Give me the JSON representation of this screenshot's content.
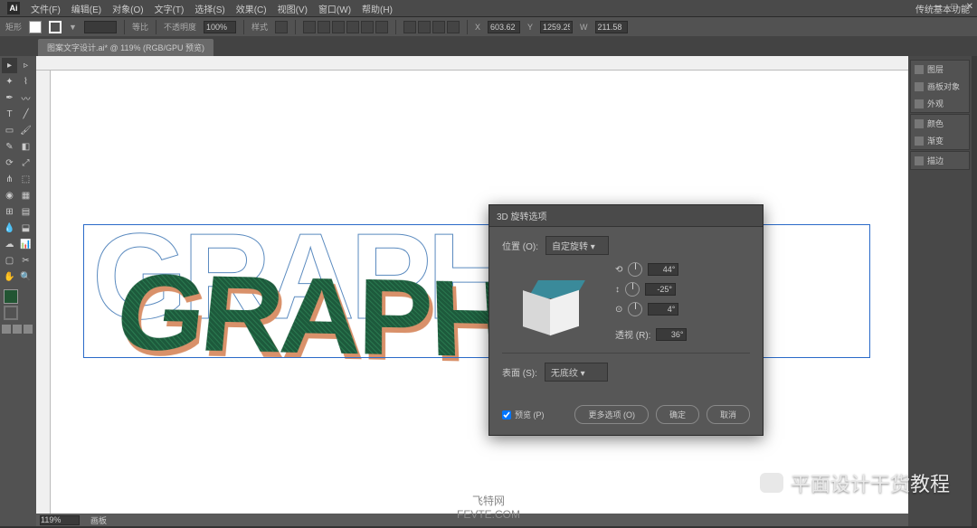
{
  "app": {
    "logo": "Ai",
    "title": "传统基本功能"
  },
  "menu": [
    "文件(F)",
    "编辑(E)",
    "对象(O)",
    "文字(T)",
    "选择(S)",
    "效果(C)",
    "视图(V)",
    "窗口(W)",
    "帮助(H)"
  ],
  "window_controls": [
    "—",
    "□",
    "✕"
  ],
  "options": {
    "label1": "矩形",
    "stroke_mode": "▼",
    "stroke_width": "",
    "uniform": "等比",
    "opacity_label": "不透明度",
    "opacity_val": "100%",
    "style_label": "样式",
    "align_label": "对齐",
    "x_label": "X",
    "x_val": "603.62",
    "y_label": "Y",
    "y_val": "1259.25",
    "w_label": "W",
    "w_val": "211.58"
  },
  "tab": {
    "name": "图案文字设计.ai* @ 119% (RGB/GPU 预览)"
  },
  "status": {
    "zoom": "119%",
    "artboard": "画板"
  },
  "panels": {
    "g1": [
      "图层",
      "画板对象",
      "外观"
    ],
    "g2": [
      "颜色",
      "渐变"
    ],
    "g3": [
      "描边"
    ]
  },
  "artwork": {
    "text": "GRAPHIC"
  },
  "dialog": {
    "title": "3D 旋转选项",
    "position_label": "位置 (O):",
    "position_val": "自定旋转",
    "axis_x_sym": "⟲",
    "axis_y_sym": "↕",
    "axis_z_sym": "⊙",
    "angle_x": "44°",
    "angle_y": "-25°",
    "angle_z": "4°",
    "perspective_label": "透视 (R):",
    "perspective_val": "36°",
    "surface_label": "表面 (S):",
    "surface_val": "无底纹",
    "preview_label": "预览 (P)",
    "more_btn": "更多选项 (O)",
    "ok_btn": "确定",
    "cancel_btn": "取消"
  },
  "watermark": {
    "center1": "飞特网",
    "center2": "FEVTE.COM",
    "right": "平面设计干货教程"
  }
}
